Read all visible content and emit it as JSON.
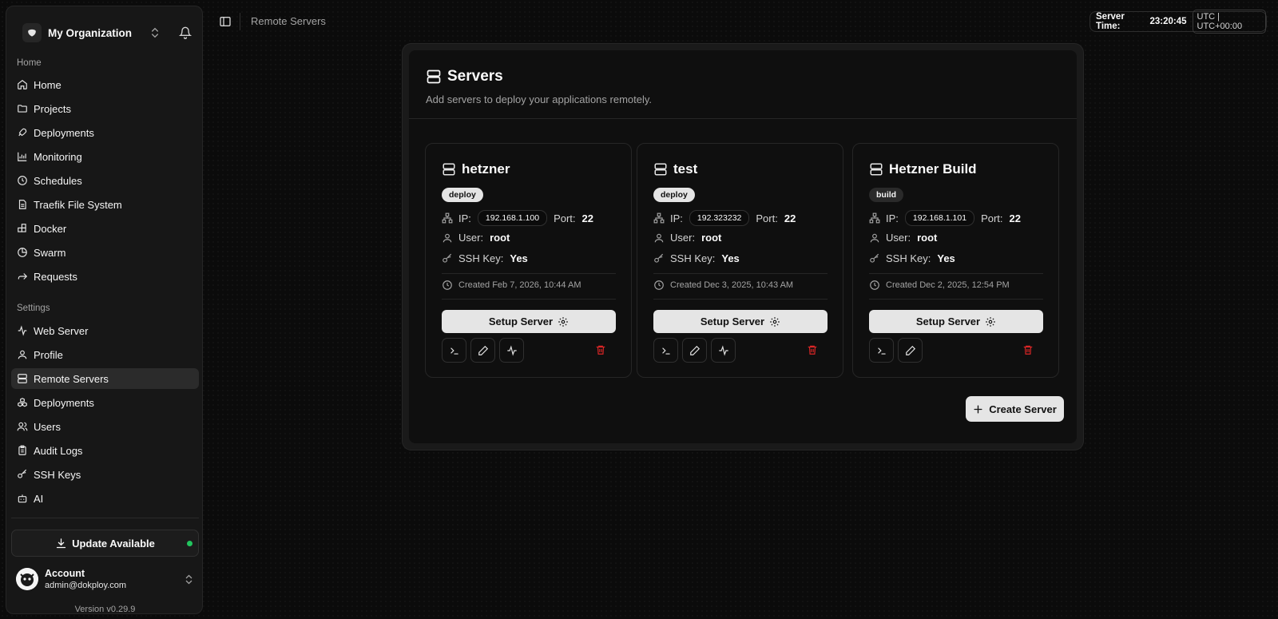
{
  "sidebar": {
    "org_name": "My Organization",
    "home_section": "Home",
    "home_items": [
      {
        "label": "Home",
        "icon": "home-icon"
      },
      {
        "label": "Projects",
        "icon": "folder-icon"
      },
      {
        "label": "Deployments",
        "icon": "rocket-icon"
      },
      {
        "label": "Monitoring",
        "icon": "chart-icon"
      },
      {
        "label": "Schedules",
        "icon": "clock-icon"
      },
      {
        "label": "Traefik File System",
        "icon": "file-icon"
      },
      {
        "label": "Docker",
        "icon": "blocks-icon"
      },
      {
        "label": "Swarm",
        "icon": "pie-icon"
      },
      {
        "label": "Requests",
        "icon": "forward-icon"
      }
    ],
    "settings_section": "Settings",
    "settings_items": [
      {
        "label": "Web Server",
        "icon": "activity-icon"
      },
      {
        "label": "Profile",
        "icon": "user-icon"
      },
      {
        "label": "Remote Servers",
        "icon": "server-icon",
        "active": true
      },
      {
        "label": "Deployments",
        "icon": "boxes-icon"
      },
      {
        "label": "Users",
        "icon": "users-icon"
      },
      {
        "label": "Audit Logs",
        "icon": "clipboard-icon"
      },
      {
        "label": "SSH Keys",
        "icon": "key-icon"
      },
      {
        "label": "AI",
        "icon": "bot-icon"
      }
    ],
    "update_label": "Update Available",
    "account_name": "Account",
    "account_email": "admin@dokploy.com",
    "version": "Version v0.29.9"
  },
  "header": {
    "breadcrumb": "Remote Servers",
    "server_time_label": "Server Time:",
    "server_time": "23:20:45",
    "timezone": "UTC | UTC+00:00"
  },
  "main": {
    "title": "Servers",
    "subtitle": "Add servers to deploy your applications remotely.",
    "labels": {
      "ip": "IP:",
      "port": "Port:",
      "user": "User:",
      "ssh_key": "SSH Key:",
      "setup": "Setup Server"
    },
    "servers": [
      {
        "name": "hetzner",
        "badge": "deploy",
        "ip": "192.168.1.100",
        "port": "22",
        "user": "root",
        "ssh_key": "Yes",
        "created": "Created Feb 7, 2026, 10:44 AM",
        "has_monitoring": true
      },
      {
        "name": "test",
        "badge": "deploy",
        "ip": "192.323232",
        "port": "22",
        "user": "root",
        "ssh_key": "Yes",
        "created": "Created Dec 3, 2025, 10:43 AM",
        "has_monitoring": true
      },
      {
        "name": "Hetzner Build",
        "badge": "build",
        "ip": "192.168.1.101",
        "port": "22",
        "user": "root",
        "ssh_key": "Yes",
        "created": "Created Dec 2, 2025, 12:54 PM",
        "has_monitoring": false
      }
    ],
    "create_label": "Create Server"
  },
  "colors": {
    "background": "#0b0b0b",
    "panel": "#171717",
    "danger": "#dc2626",
    "success": "#22c55e",
    "button_light": "#e5e5e5"
  }
}
